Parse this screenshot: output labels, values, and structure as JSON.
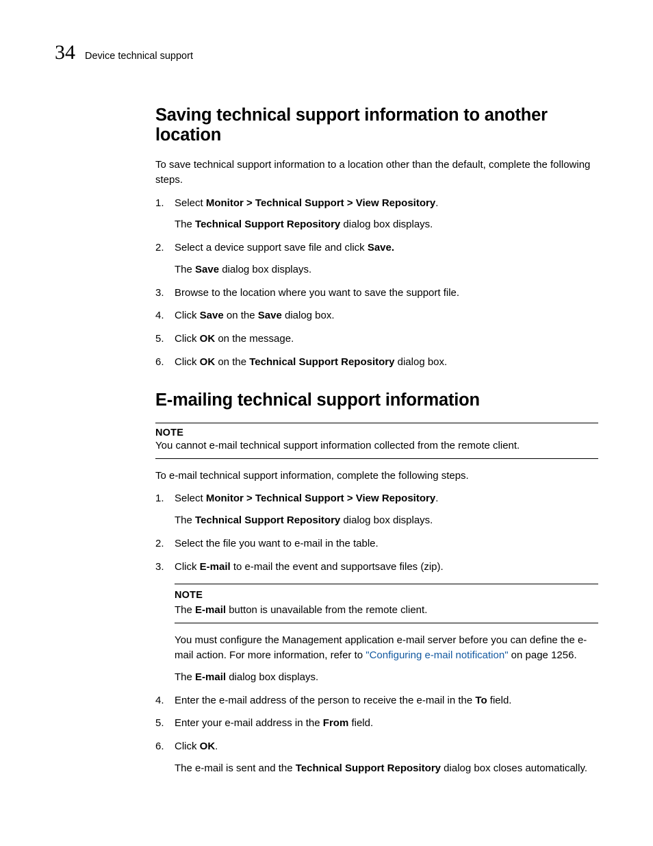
{
  "header": {
    "chapter_number": "34",
    "running_head": "Device technical support"
  },
  "section1": {
    "title": "Saving technical support information to another location",
    "intro": "To save technical support information to a location other than the default, complete the following steps.",
    "s1_select_pre": "Select ",
    "s1_select_bold": "Monitor > Technical Support > View Repository",
    "s1_select_post": ".",
    "s1_sub_pre": "The ",
    "s1_sub_bold": "Technical Support Repository",
    "s1_sub_post": " dialog box displays.",
    "s2_pre": "Select a device support save file and click ",
    "s2_bold": "Save.",
    "s2_sub_pre": "The ",
    "s2_sub_bold": "Save",
    "s2_sub_post": " dialog box displays.",
    "s3": "Browse to the location where you want to save the support file.",
    "s4_pre": "Click ",
    "s4_b1": "Save",
    "s4_mid": " on the ",
    "s4_b2": "Save",
    "s4_post": " dialog box.",
    "s5_pre": "Click ",
    "s5_b1": "OK",
    "s5_post": " on the message.",
    "s6_pre": "Click ",
    "s6_b1": "OK",
    "s6_mid": " on the ",
    "s6_b2": "Technical Support Repository",
    "s6_post": " dialog box."
  },
  "section2": {
    "title": "E-mailing technical support information",
    "note1_label": "NOTE",
    "note1_text": "You cannot e-mail technical support information collected from the remote client.",
    "intro": "To e-mail technical support information, complete the following steps.",
    "s1_select_pre": "Select ",
    "s1_select_bold": "Monitor > Technical Support > View Repository",
    "s1_select_post": ".",
    "s1_sub_pre": "The ",
    "s1_sub_bold": "Technical Support Repository",
    "s1_sub_post": " dialog box displays.",
    "s2": "Select the file you want to e-mail in the table.",
    "s3_pre": "Click ",
    "s3_b1": "E-mail",
    "s3_post": " to e-mail the event and supportsave files (zip).",
    "note2_label": "NOTE",
    "note2_pre": "The ",
    "note2_b1": "E-mail",
    "note2_post": " button is unavailable from the remote client.",
    "p_config_pre": "You must configure the Management application e-mail server before you can define the e-mail action. For more information, refer to ",
    "p_config_link": "\"Configuring e-mail notification\"",
    "p_config_post": " on page 1256.",
    "p_email_pre": "The ",
    "p_email_b1": "E-mail",
    "p_email_post": " dialog box displays.",
    "s4_pre": "Enter the e-mail address of the person to receive the e-mail in the ",
    "s4_b1": "To",
    "s4_post": " field.",
    "s5_pre": "Enter your e-mail address in the ",
    "s5_b1": "From",
    "s5_post": " field.",
    "s6_pre": "Click ",
    "s6_b1": "OK",
    "s6_post": ".",
    "s6_sub_pre": "The e-mail is sent and the ",
    "s6_sub_b1": "Technical Support Repository",
    "s6_sub_post": " dialog box closes automatically."
  },
  "numbers": {
    "n1": "1.",
    "n2": "2.",
    "n3": "3.",
    "n4": "4.",
    "n5": "5.",
    "n6": "6."
  }
}
